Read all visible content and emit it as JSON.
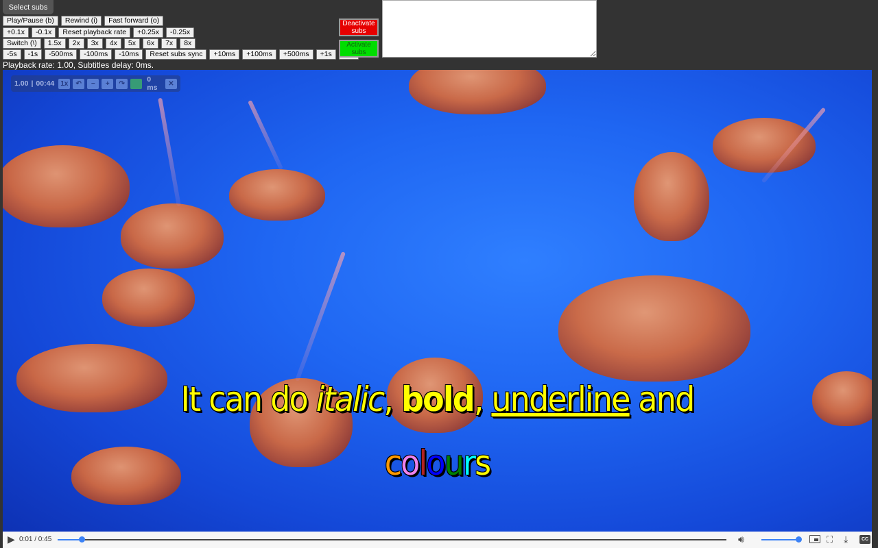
{
  "toolbar": {
    "select_subs": "Select subs",
    "row1": [
      "Play/Pause (b)",
      "Rewind (i)",
      "Fast forward (o)"
    ],
    "row2": [
      "+0.1x",
      "-0.1x",
      "Reset playback rate",
      "+0.25x",
      "-0.25x"
    ],
    "row3": [
      "Switch (\\)",
      "1.5x",
      "2x",
      "3x",
      "4x",
      "5x",
      "6x",
      "7x",
      "8x"
    ],
    "row4": [
      "-5s",
      "-1s",
      "-500ms",
      "-100ms",
      "-10ms",
      "Reset subs sync",
      "+10ms",
      "+100ms",
      "+500ms",
      "+1s",
      "+5s"
    ],
    "deactivate": "Deactivate subs",
    "activate": "Activate subs",
    "status": "Playback rate: 1.00, Subtitles delay: 0ms.",
    "subs_textarea_value": ""
  },
  "overlay": {
    "rate": "1.00",
    "separator": "|",
    "time_remaining": "00:44",
    "speed_button": "1x",
    "rewind": "↶",
    "minus": "−",
    "plus": "+",
    "forward": "↷",
    "delay": "0 ms",
    "close": "✕"
  },
  "subtitles": {
    "line1": {
      "plain1": "It can do ",
      "italic": "italic",
      "sep1": ", ",
      "bold": "bold",
      "sep2": ", ",
      "underline": "underline",
      "plain2": " and"
    },
    "line2_letters": [
      {
        "ch": "c",
        "color": "#ff9900"
      },
      {
        "ch": "o",
        "color": "#ee82ee"
      },
      {
        "ch": "l",
        "color": "#b22222"
      },
      {
        "ch": "o",
        "color": "#0000ff"
      },
      {
        "ch": "u",
        "color": "#008000"
      },
      {
        "ch": "r",
        "color": "#00ffff"
      },
      {
        "ch": "s",
        "color": "#ffff00"
      }
    ]
  },
  "player": {
    "time": "0:01 / 0:45",
    "progress_fraction": 0.022,
    "volume_fraction": 1.0,
    "accent_color": "#3b82f6"
  }
}
